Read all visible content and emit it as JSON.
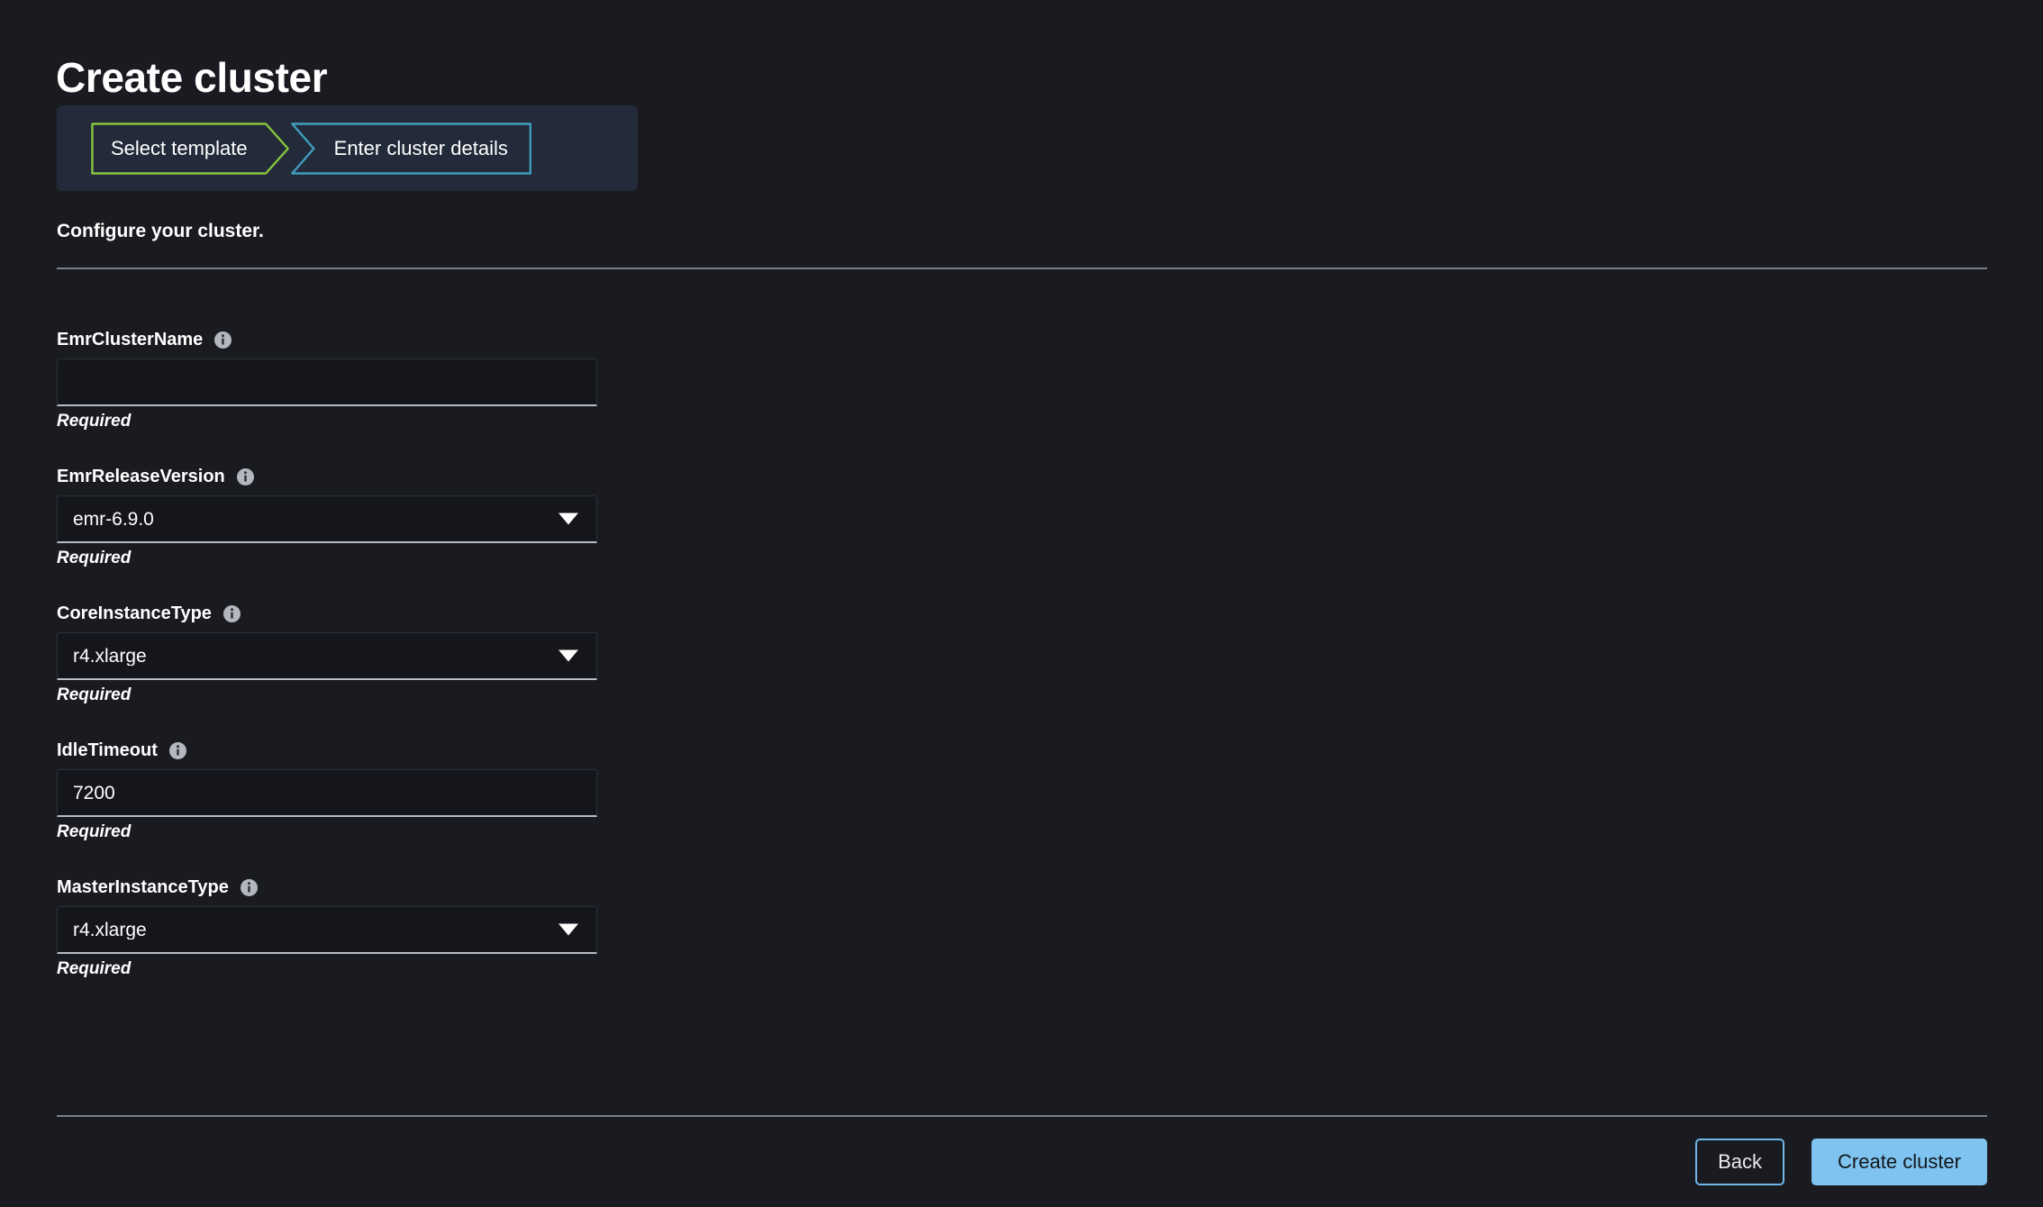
{
  "page": {
    "title": "Create cluster",
    "subtitle": "Configure your cluster."
  },
  "wizard": {
    "steps": [
      {
        "label": "Select template",
        "state": "completed",
        "color": "#89c540"
      },
      {
        "label": "Enter cluster details",
        "state": "current",
        "color": "#3e9dbd"
      }
    ]
  },
  "form": {
    "fields": [
      {
        "label": "EmrClusterName",
        "control": "text",
        "value": "",
        "placeholder": "",
        "hint": "Required",
        "info_icon": "info-icon"
      },
      {
        "label": "EmrReleaseVersion",
        "control": "select",
        "value": "emr-6.9.0",
        "placeholder": "",
        "hint": "Required",
        "info_icon": "info-icon"
      },
      {
        "label": "CoreInstanceType",
        "control": "select",
        "value": "r4.xlarge",
        "placeholder": "",
        "hint": "Required",
        "info_icon": "info-icon"
      },
      {
        "label": "IdleTimeout",
        "control": "text",
        "value": "7200",
        "placeholder": "",
        "hint": "Required",
        "info_icon": "info-icon"
      },
      {
        "label": "MasterInstanceType",
        "control": "select",
        "value": "r4.xlarge",
        "placeholder": "",
        "hint": "Required",
        "info_icon": "info-icon"
      }
    ]
  },
  "actions": {
    "back_label": "Back",
    "create_label": "Create cluster"
  },
  "colors": {
    "page_background": "#1a1b20",
    "panel_background": "#232b3a",
    "step_completed": "#89c540",
    "step_current": "#3e9dbd",
    "primary_button": "#7fc4f0",
    "divider": "#7d8089",
    "input_background": "#14161c",
    "input_underline": "#b9bcc6"
  }
}
